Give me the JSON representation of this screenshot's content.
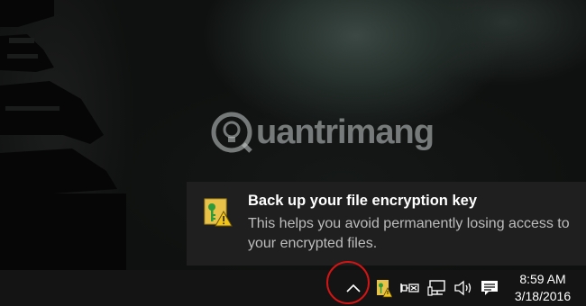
{
  "watermark": {
    "text": "uantrimang"
  },
  "notification": {
    "title": "Back up your file encryption key",
    "body": "This helps you avoid permanently losing access to your encrypted files."
  },
  "tray": {
    "icons": [
      "chevron-up-icon",
      "encryption-key-icon",
      "power-plug-icon",
      "network-icon",
      "volume-icon",
      "action-center-icon"
    ]
  },
  "clock": {
    "time": "8:59 AM",
    "date": "3/18/2016"
  },
  "colors": {
    "highlight_circle": "#d21414",
    "taskbar": "#141414",
    "toast_bg": "#1f1f1f"
  }
}
